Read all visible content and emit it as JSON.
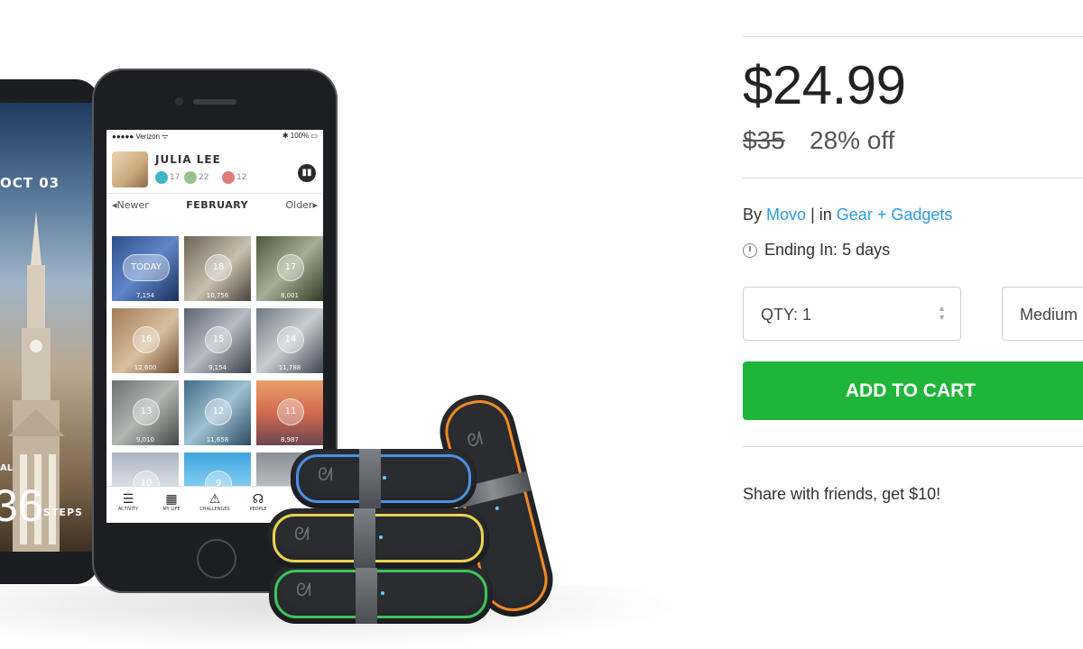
{
  "product": {
    "price": "$24.99",
    "original_price": "$35",
    "discount": "28% off",
    "byline_prefix": "By",
    "vendor": "Movo",
    "separator": "|",
    "in_label": "in",
    "category": "Gear + Gadgets",
    "ending_label": "Ending In: 5 days"
  },
  "purchase": {
    "qty_label": "QTY: 1",
    "size_value": "Medium",
    "add_to_cart": "ADD TO CART",
    "share_text": "Share with friends, get $10!"
  },
  "colors": {
    "accent_blue": "#2b9be1",
    "cart_green": "#1fb53b",
    "band_blue": "#4a90e2",
    "band_yellow": "#e8d44d",
    "band_green": "#3cc45a",
    "band_orange": "#f08a24"
  },
  "device_image": {
    "lock_screen": {
      "date": "OCT 03",
      "al": "AL",
      "big_number": "36",
      "steps_label": "STEPS"
    },
    "app": {
      "carrier": "●●●●● Verizon ᯤ",
      "battery": "✱ 100% ▭",
      "user_name": "JULIA LEE",
      "stat_1": "17",
      "stat_2": "22",
      "stat_3": "12",
      "nav_newer": "◂Newer",
      "nav_month": "FEBRUARY",
      "nav_older": "Older▸",
      "tiles": [
        {
          "label": "TODAY",
          "steps": "7,154"
        },
        {
          "label": "18",
          "steps": "10,756"
        },
        {
          "label": "17",
          "steps": "8,001"
        },
        {
          "label": "16",
          "steps": "12,600"
        },
        {
          "label": "15",
          "steps": "9,154"
        },
        {
          "label": "14",
          "steps": "11,788"
        },
        {
          "label": "13",
          "steps": "9,010"
        },
        {
          "label": "12",
          "steps": "11,658"
        },
        {
          "label": "11",
          "steps": "8,987"
        },
        {
          "label": "10",
          "steps": ""
        },
        {
          "label": "9",
          "steps": ""
        },
        {
          "label": "",
          "steps": ""
        }
      ],
      "tabs": [
        {
          "icon": "☰",
          "label": "ACTIVITY"
        },
        {
          "icon": "▦",
          "label": "MY LIFE"
        },
        {
          "icon": "⚠",
          "label": "CHALLENGES"
        },
        {
          "icon": "☊",
          "label": "PEOPLE"
        },
        {
          "icon": "",
          "label": ""
        }
      ]
    }
  }
}
